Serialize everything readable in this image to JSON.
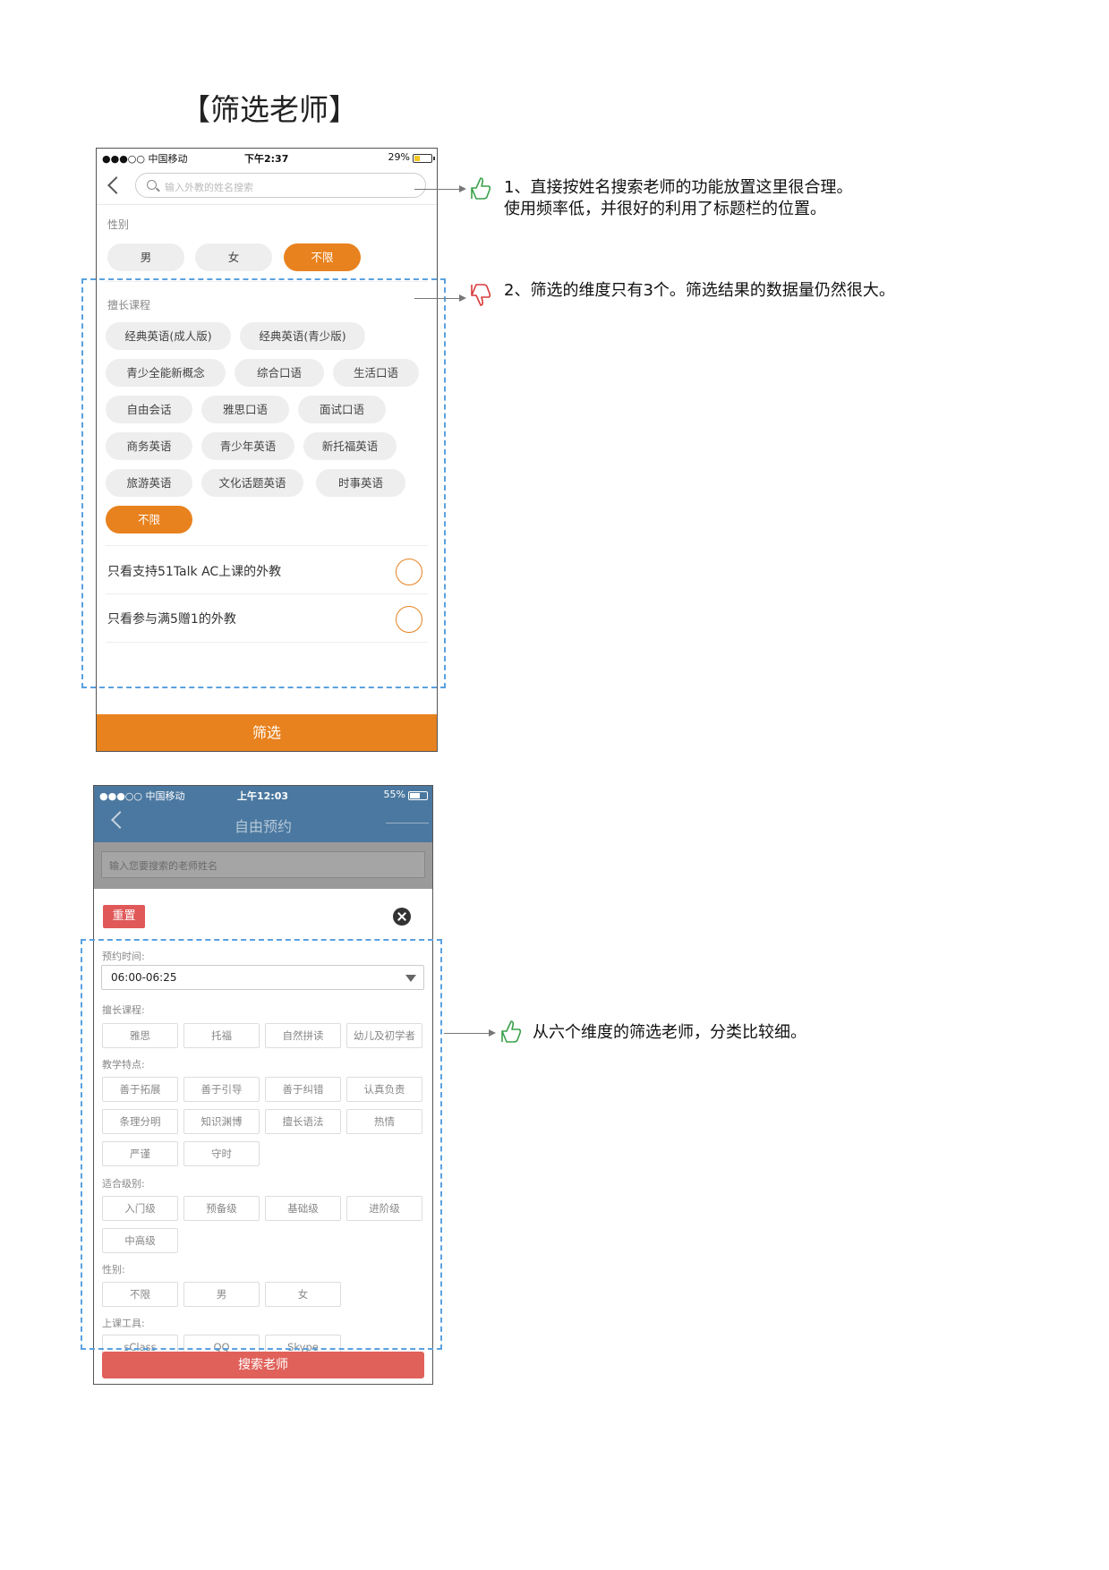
{
  "page_title": "【筛选老师】",
  "phone1": {
    "status": {
      "carrier": "●●●○○ 中国移动",
      "time": "下午2:37",
      "battery": "29%",
      "battery_level": 0.29
    },
    "search_placeholder": "输入外教的姓名搜索",
    "gender_label": "性别",
    "gender_options": [
      "男",
      "女",
      "不限"
    ],
    "course_label": "擅长课程",
    "course_rows": [
      [
        "经典英语(成人版)",
        "经典英语(青少版)"
      ],
      [
        "青少全能新概念",
        "综合口语",
        "生活口语"
      ],
      [
        "自由会话",
        "雅思口语",
        "面试口语"
      ],
      [
        "商务英语",
        "青少年英语",
        "新托福英语"
      ],
      [
        "旅游英语",
        "文化话题英语",
        "时事英语"
      ],
      [
        "不限"
      ]
    ],
    "toggles": [
      "只看支持51Talk AC上课的外教",
      "只看参与满5赠1的外教"
    ],
    "submit": "筛选"
  },
  "phone2": {
    "status": {
      "carrier": "●●●○○ 中国移动",
      "time": "上午12:03",
      "battery": "55%",
      "battery_level": 0.55
    },
    "nav_title": "自由预约",
    "search_placeholder": "输入您要搜索的老师姓名",
    "reset": "重置",
    "time_label": "预约时间:",
    "time_value": "06:00-06:25",
    "course_label": "擅长课程:",
    "courses": [
      "雅思",
      "托福",
      "自然拼读",
      "幼儿及初学者"
    ],
    "feature_label": "教学特点:",
    "features": [
      [
        "善于拓展",
        "善于引导",
        "善于纠错",
        "认真负责"
      ],
      [
        "条理分明",
        "知识渊博",
        "擅长语法",
        "热情"
      ],
      [
        "严谨",
        "守时"
      ]
    ],
    "level_label": "适合级别:",
    "levels": [
      [
        "入门级",
        "预备级",
        "基础级",
        "进阶级"
      ],
      [
        "中高级"
      ]
    ],
    "gender_label": "性别:",
    "genders": [
      "不限",
      "男",
      "女"
    ],
    "tool_label": "上课工具:",
    "tools": [
      "sClass",
      "QQ",
      "Skype"
    ],
    "submit": "搜索老师"
  },
  "annotations": {
    "note1_line1": "1、直接按姓名搜索老师的功能放置这里很合理。",
    "note1_line2": "使用频率低，并很好的利用了标题栏的位置。",
    "note2": "2、筛选的维度只有3个。筛选结果的数据量仍然很大。",
    "note3": "从六个维度的筛选老师，分类比较细。"
  },
  "colors": {
    "orange": "#e8821e",
    "nav_blue": "#4b78a0",
    "red": "#e05858",
    "dash_blue": "#5aa1df"
  }
}
